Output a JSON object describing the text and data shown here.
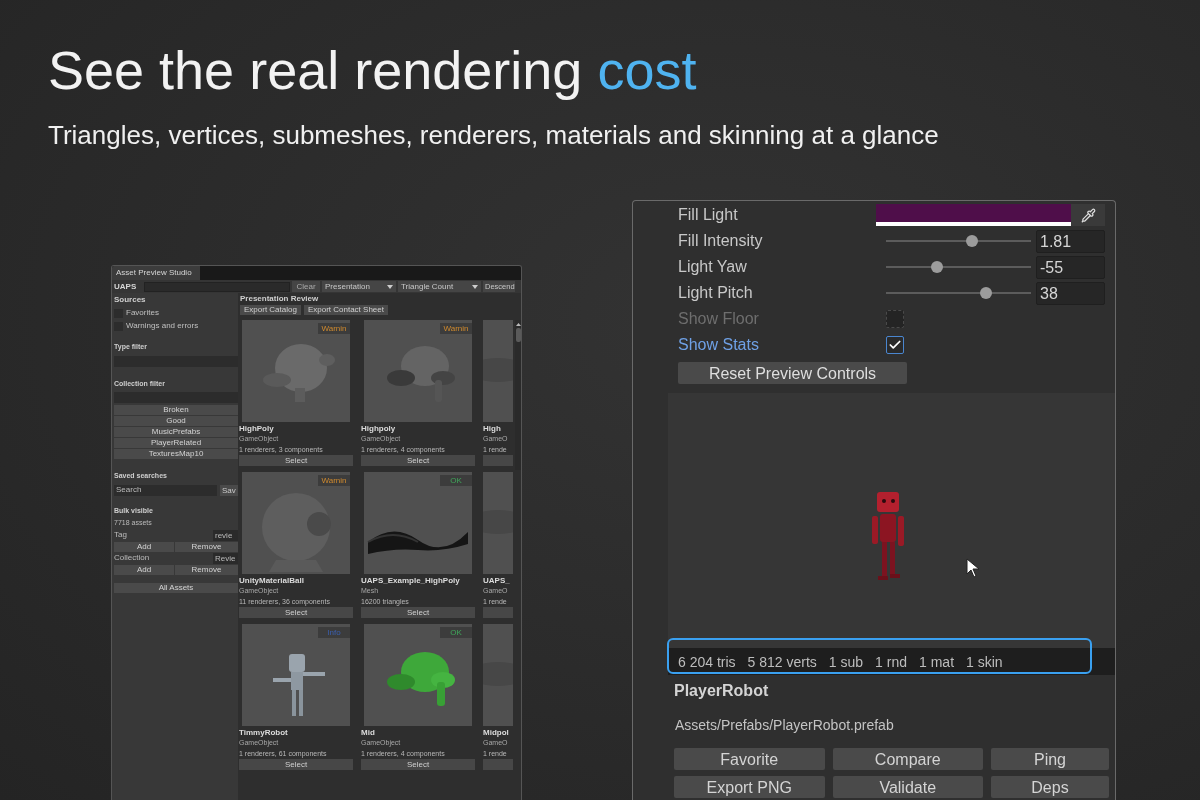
{
  "headline": {
    "text": "See the real rendering",
    "highlight": "cost"
  },
  "subtitle": "Triangles, vertices, submeshes, renderers, materials and skinning at a glance",
  "browser_window": {
    "tab": "Asset Preview Studio",
    "toolbar": {
      "label": "UAPS",
      "clear": "Clear",
      "dropdowns": [
        "Presentation",
        "Triangle Count"
      ],
      "sort": "Descend"
    },
    "sidebar": {
      "sources_label": "Sources",
      "sources": [
        {
          "label": "Favorites",
          "checked": false
        },
        {
          "label": "Warnings and errors",
          "checked": false
        }
      ],
      "type_filter": "Type filter",
      "collection_filter": "Collection filter",
      "collections": [
        "Broken",
        "Good",
        "MusicPrefabs",
        "PlayerRelated",
        "TexturesMap10"
      ],
      "saved_searches": {
        "label": "Saved searches",
        "placeholder": "Search",
        "button": "Sav"
      },
      "bulk": {
        "label": "Bulk visible",
        "count": "7718 assets"
      },
      "bulk_rows": [
        {
          "label": "Tag",
          "value": "revie",
          "add": "Add",
          "remove": "Remove"
        },
        {
          "label": "Collection",
          "value": "Revie",
          "add": "Add",
          "remove": "Remove"
        }
      ],
      "all_assets": "All Assets"
    },
    "section_title": "Presentation Review",
    "actions": [
      "Export Catalog",
      "Export Contact Sheet"
    ],
    "card_rows": [
      [
        {
          "name": "HighPoly",
          "type": "GameObject",
          "info": "1 renderers, 3 components",
          "badge": {
            "label": "Warnin",
            "kind": "warning"
          },
          "button": "Select"
        },
        {
          "name": "Highpoly",
          "type": "GameObject",
          "info": "1 renderers, 4 components",
          "badge": {
            "label": "Warnin",
            "kind": "warning"
          },
          "button": "Select"
        },
        {
          "name": "High",
          "type": "GameO",
          "info": "1 rende"
        }
      ],
      [
        {
          "name": "UnityMaterialBall",
          "type": "GameObject",
          "info": "11 renderers, 36 components",
          "badge": {
            "label": "Warnin",
            "kind": "warning"
          },
          "button": "Select"
        },
        {
          "name": "UAPS_Example_HighPoly",
          "type": "Mesh",
          "info": "16200 triangles",
          "badge": {
            "label": "OK",
            "kind": "ok"
          },
          "button": "Select"
        },
        {
          "name": "UAPS_",
          "type": "GameO",
          "info": "1 rende"
        }
      ],
      [
        {
          "name": "TimmyRobot",
          "type": "GameObject",
          "info": "1 renderers, 61 components",
          "badge": {
            "label": "Info",
            "kind": "info"
          },
          "button": "Select"
        },
        {
          "name": "Mid",
          "type": "GameObject",
          "info": "1 renderers, 4 components",
          "badge": {
            "label": "OK",
            "kind": "ok"
          },
          "button": "Select"
        },
        {
          "name": "Midpol",
          "type": "GameO",
          "info": "1 rende"
        }
      ]
    ]
  },
  "preview_window": {
    "rows": [
      {
        "kind": "color",
        "label": "Fill Light",
        "color": "#4f0e4a"
      },
      {
        "kind": "slider",
        "label": "Fill Intensity",
        "level": 0.59,
        "value": "1.81"
      },
      {
        "kind": "slider",
        "label": "Light Yaw",
        "level": 0.35,
        "value": "-55"
      },
      {
        "kind": "slider",
        "label": "Light Pitch",
        "level": 0.69,
        "value": "38"
      },
      {
        "kind": "checkbox",
        "label": "Show Floor",
        "checked": false,
        "disabled": true,
        "focused": false
      },
      {
        "kind": "checkbox",
        "label": "Show Stats",
        "checked": true,
        "disabled": false,
        "focused": true
      }
    ],
    "reset_button": "Reset Preview Controls",
    "stats": {
      "highlighted": true,
      "items": [
        "6 204 tris",
        "5 812 verts",
        "1 sub",
        "1 rnd",
        "1 mat",
        "1 skin"
      ]
    },
    "asset_name": "PlayerRobot",
    "asset_path": "Assets/Prefabs/PlayerRobot.prefab",
    "button_rows": [
      {
        "buttons": [
          "Favorite",
          "Compare",
          "Ping"
        ]
      },
      {
        "buttons": [
          "Export PNG",
          "Validate",
          "Deps"
        ]
      }
    ]
  }
}
